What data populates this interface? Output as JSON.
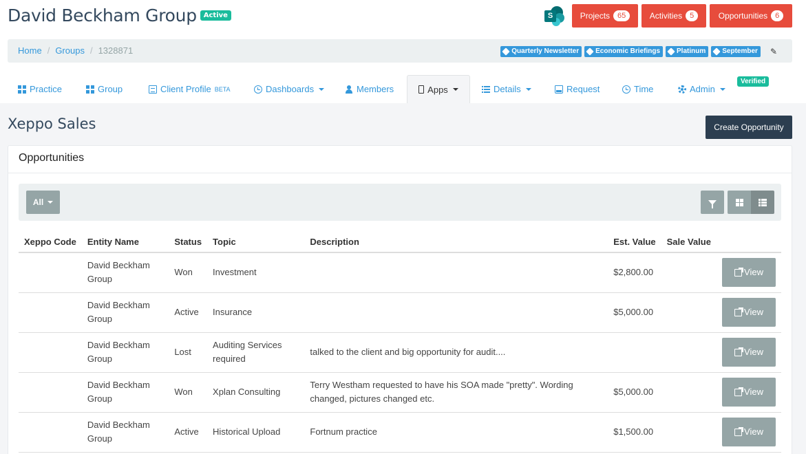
{
  "header": {
    "group_name": "David Beckham Group",
    "status_badge": "Active",
    "sharepoint_icon": "sharepoint-logo-icon",
    "buttons": [
      {
        "label": "Projects",
        "count": "65"
      },
      {
        "label": "Activities",
        "count": "5"
      },
      {
        "label": "Opportunities",
        "count": "6"
      }
    ],
    "accent_color": "#e74c3c"
  },
  "breadcrumb": {
    "items": [
      "Home",
      "Groups",
      "1328871"
    ]
  },
  "tags": [
    "Quarterly Newsletter",
    "Economic Briefings",
    "Platinum",
    "September"
  ],
  "nav": {
    "items": [
      {
        "label": "Practice",
        "icon": "grid-icon"
      },
      {
        "label": "Group",
        "icon": "grid-icon"
      },
      {
        "label": "Client Profile",
        "suffix": "BETA",
        "icon": "document-icon"
      },
      {
        "label": "Dashboards",
        "icon": "dashboard-icon"
      },
      {
        "label": "Members",
        "icon": "user-icon"
      },
      {
        "label": "Apps",
        "icon": "phone-icon"
      },
      {
        "label": "Details",
        "icon": "list-icon"
      },
      {
        "label": "Request",
        "icon": "inbox-icon"
      },
      {
        "label": "Time",
        "icon": "clock-icon"
      },
      {
        "label": "Admin",
        "icon": "gear-icon"
      }
    ],
    "verified_badge": "Verified"
  },
  "page": {
    "title": "Xeppo Sales",
    "create_button": "Create Opportunity"
  },
  "panel": {
    "title": "Opportunities",
    "filter_label": "All"
  },
  "table": {
    "columns": [
      "Xeppo Code",
      "Entity Name",
      "Status",
      "Topic",
      "Description",
      "Est. Value",
      "Sale Value"
    ],
    "view_label": "View",
    "rows": [
      {
        "code": "",
        "entity": "David Beckham Group",
        "status": "Won",
        "topic": "Investment",
        "description": "",
        "est": "$2,800.00",
        "sale": ""
      },
      {
        "code": "",
        "entity": "David Beckham Group",
        "status": "Active",
        "topic": "Insurance",
        "description": "",
        "est": "$5,000.00",
        "sale": ""
      },
      {
        "code": "",
        "entity": "David Beckham Group",
        "status": "Lost",
        "topic": "Auditing Services required",
        "description": "talked to the client and big opportunity for audit....",
        "est": "",
        "sale": ""
      },
      {
        "code": "",
        "entity": "David Beckham Group",
        "status": "Won",
        "topic": "Xplan Consulting",
        "description": "Terry Westham requested to have his SOA made \"pretty\". Wording changed, pictures changed etc.",
        "est": "$5,000.00",
        "sale": ""
      },
      {
        "code": "",
        "entity": "David Beckham Group",
        "status": "Active",
        "topic": "Historical Upload",
        "description": "Fortnum practice",
        "est": "$1,500.00",
        "sale": ""
      }
    ]
  }
}
